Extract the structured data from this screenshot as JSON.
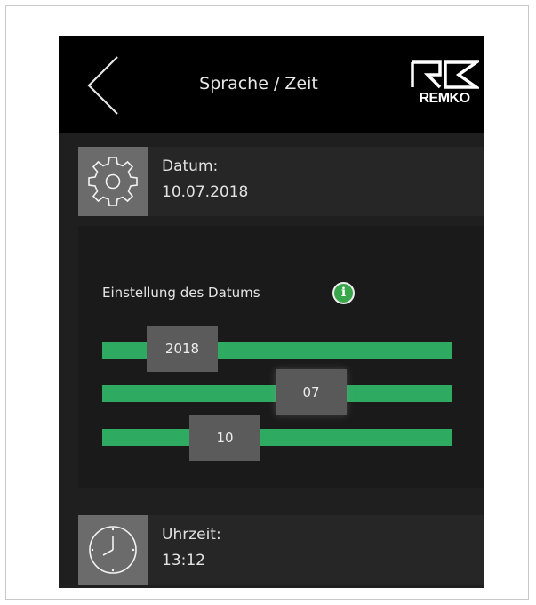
{
  "header": {
    "title": "Sprache / Zeit",
    "logo_text": "REMKO",
    "back_icon": "chevron-left-icon"
  },
  "date_row": {
    "icon": "gear-icon",
    "label": "Datum:",
    "value": "10.07.2018"
  },
  "date_panel": {
    "label": "Einstellung des Datums",
    "info_icon": "info-icon",
    "info_symbol": "i",
    "year": "2018",
    "month": "07",
    "day": "10"
  },
  "time_row": {
    "icon": "clock-icon",
    "label": "Uhrzeit:",
    "value": "13:12"
  },
  "colors": {
    "accent_green": "#2eaa61",
    "header_bg": "#000000",
    "screen_bg": "#1f1f1f",
    "icon_box": "#6b6b6b"
  }
}
